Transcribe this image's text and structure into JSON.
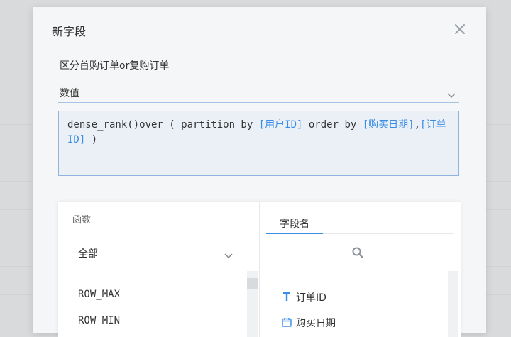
{
  "dialog": {
    "title": "新字段",
    "field_name_value": "区分首购订单or复购订单",
    "value_type": "数值",
    "formula": [
      {
        "text": "dense_rank()over ( partition by ",
        "kind": "plain"
      },
      {
        "text": "[用户ID]",
        "kind": "field"
      },
      {
        "text": " order by ",
        "kind": "plain"
      },
      {
        "text": "[购买日期]",
        "kind": "field"
      },
      {
        "text": ",",
        "kind": "plain"
      },
      {
        "text": "[订单ID]",
        "kind": "field"
      },
      {
        "text": " )",
        "kind": "plain"
      }
    ]
  },
  "functions": {
    "heading": "函数",
    "category": "全部",
    "items": [
      "ROW_MAX",
      "ROW_MIN"
    ]
  },
  "fields": {
    "tab_label": "字段名",
    "items": [
      {
        "label": "订单ID",
        "icon": "text-type-icon"
      },
      {
        "label": "购买日期",
        "icon": "calendar-icon"
      }
    ]
  },
  "colors": {
    "accent": "#3a8ee6",
    "formula_bg": "#ebf0f7"
  }
}
